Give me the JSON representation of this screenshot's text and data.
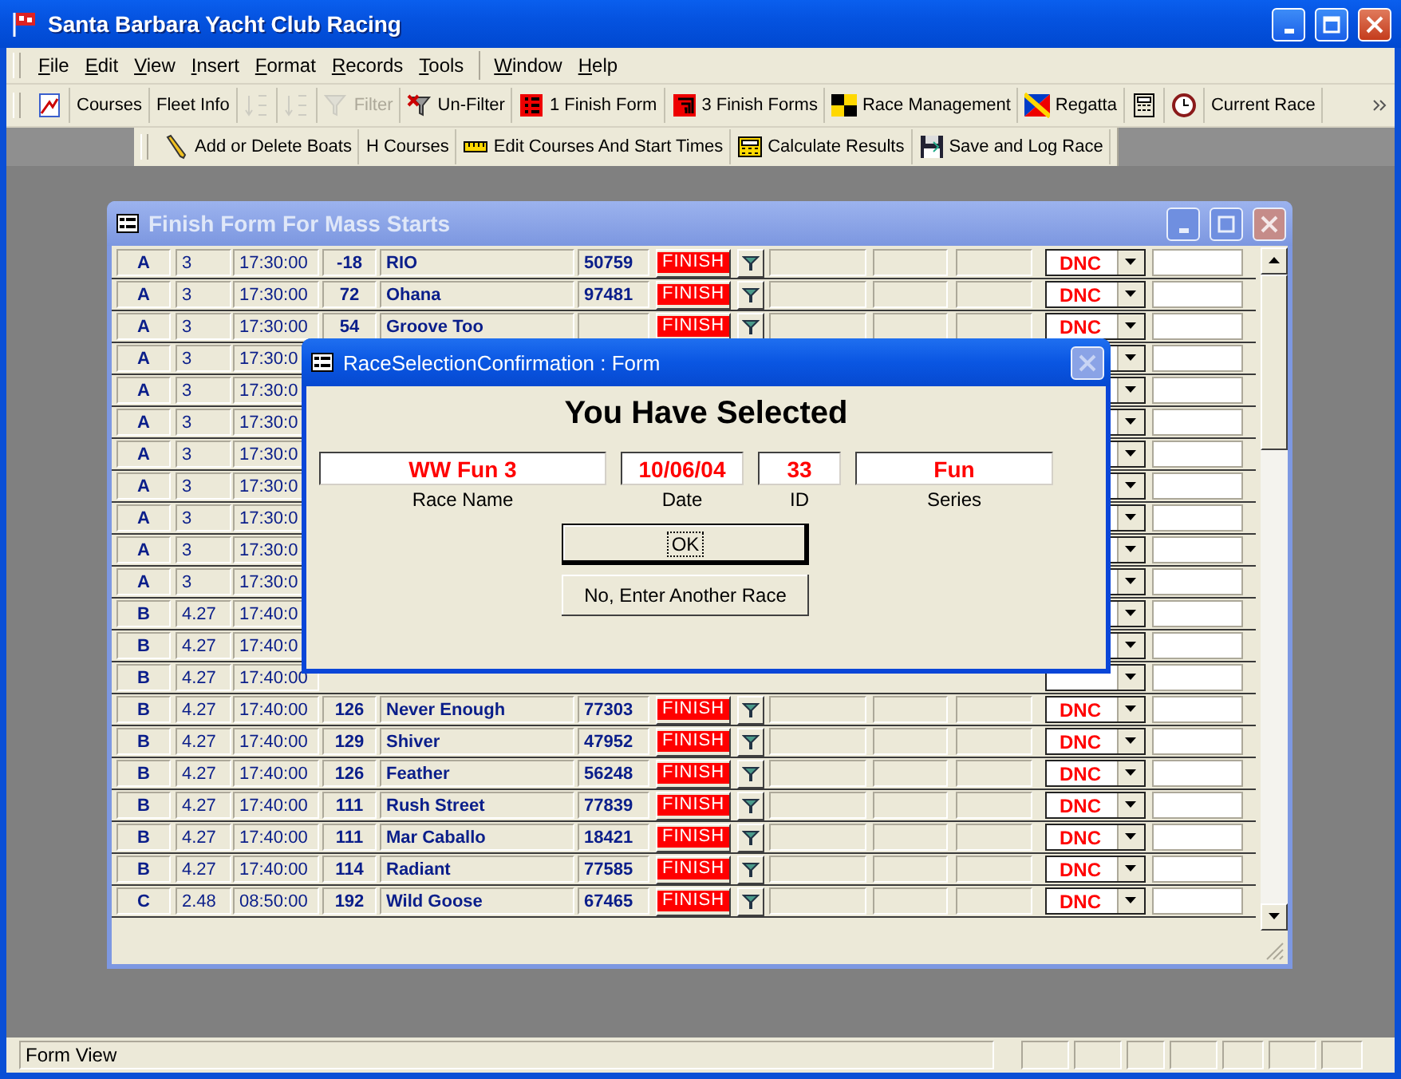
{
  "window": {
    "title": "Santa Barbara Yacht Club Racing"
  },
  "menu": [
    [
      {
        "label": "File"
      },
      {
        "label": "Edit"
      },
      {
        "label": "View"
      },
      {
        "label": "Insert"
      },
      {
        "label": "Format"
      },
      {
        "label": "Records"
      },
      {
        "label": "Tools"
      }
    ],
    [
      {
        "label": "Window"
      },
      {
        "label": "Help"
      }
    ]
  ],
  "toolbar": [
    {
      "kind": "icon",
      "disabled": false
    },
    {
      "kind": "text",
      "label": "Courses",
      "disabled": false
    },
    {
      "kind": "text",
      "label": "Fleet Info",
      "disabled": false
    },
    {
      "kind": "icon",
      "disabled": true
    },
    {
      "kind": "icon",
      "disabled": true
    },
    {
      "kind": "icon-text",
      "label": "Filter",
      "disabled": true
    },
    {
      "kind": "icon-text",
      "label": "Un-Filter",
      "disabled": false
    },
    {
      "kind": "icon-text",
      "label": "1 Finish Form",
      "disabled": false
    },
    {
      "kind": "icon-text",
      "label": "3 Finish Forms",
      "disabled": false
    },
    {
      "kind": "icon-text",
      "label": "Race Management",
      "disabled": false
    },
    {
      "kind": "icon-text",
      "label": "Regatta",
      "disabled": false
    },
    {
      "kind": "icon",
      "disabled": false
    },
    {
      "kind": "icon",
      "disabled": false
    },
    {
      "kind": "text",
      "label": "Current Race",
      "disabled": false
    }
  ],
  "toolbar_2": [
    {
      "kind": "icon-text",
      "label": "Add or Delete Boats"
    },
    {
      "kind": "text",
      "label": "H Courses"
    },
    {
      "kind": "icon-text",
      "label": "Edit Courses And Start Times"
    },
    {
      "kind": "icon-text",
      "label": "Calculate Results"
    },
    {
      "kind": "icon-text",
      "label": "Save and Log Race"
    }
  ],
  "finish_form": {
    "title": "Finish Form For Mass Starts",
    "rows": [
      {
        "kind": "full",
        "class": "A",
        "rating": "3",
        "start": "17:30:00",
        "handicap": "-18",
        "boat": "RIO",
        "sail": "50759",
        "finish": "FINISH",
        "status": "DNC"
      },
      {
        "kind": "full",
        "class": "A",
        "rating": "3",
        "start": "17:30:00",
        "handicap": "72",
        "boat": "Ohana",
        "sail": "97481",
        "finish": "FINISH",
        "status": "DNC"
      },
      {
        "kind": "full",
        "class": "A",
        "rating": "3",
        "start": "17:30:00",
        "handicap": "54",
        "boat": "Groove Too",
        "finish": "FINISH",
        "status": "DNC"
      },
      {
        "kind": "covered",
        "class": "A",
        "rating": "3",
        "start": "17:30:0"
      },
      {
        "kind": "covered",
        "class": "A",
        "rating": "3",
        "start": "17:30:0"
      },
      {
        "kind": "covered",
        "class": "A",
        "rating": "3",
        "start": "17:30:0"
      },
      {
        "kind": "covered",
        "class": "A",
        "rating": "3",
        "start": "17:30:0"
      },
      {
        "kind": "covered",
        "class": "A",
        "rating": "3",
        "start": "17:30:0"
      },
      {
        "kind": "covered",
        "class": "A",
        "rating": "3",
        "start": "17:30:0"
      },
      {
        "kind": "covered",
        "class": "A",
        "rating": "3",
        "start": "17:30:0"
      },
      {
        "kind": "covered",
        "class": "A",
        "rating": "3",
        "start": "17:30:0"
      },
      {
        "kind": "covered",
        "class": "B",
        "rating": "4.27",
        "start": "17:40:0"
      },
      {
        "kind": "covered",
        "class": "B",
        "rating": "4.27",
        "start": "17:40:0"
      },
      {
        "kind": "covered",
        "class": "B",
        "rating": "4.27",
        "start": "17:40:00"
      },
      {
        "kind": "full",
        "class": "B",
        "rating": "4.27",
        "start": "17:40:00",
        "handicap": "126",
        "boat": "Never Enough",
        "sail": "77303",
        "finish": "FINISH",
        "status": "DNC"
      },
      {
        "kind": "full",
        "class": "B",
        "rating": "4.27",
        "start": "17:40:00",
        "handicap": "129",
        "boat": "Shiver",
        "sail": "47952",
        "finish": "FINISH",
        "status": "DNC"
      },
      {
        "kind": "full",
        "class": "B",
        "rating": "4.27",
        "start": "17:40:00",
        "handicap": "126",
        "boat": "Feather",
        "sail": "56248",
        "finish": "FINISH",
        "status": "DNC"
      },
      {
        "kind": "full",
        "class": "B",
        "rating": "4.27",
        "start": "17:40:00",
        "handicap": "111",
        "boat": "Rush Street",
        "sail": "77839",
        "finish": "FINISH",
        "status": "DNC"
      },
      {
        "kind": "full",
        "class": "B",
        "rating": "4.27",
        "start": "17:40:00",
        "handicap": "111",
        "boat": "Mar Caballo",
        "sail": "18421",
        "finish": "FINISH",
        "status": "DNC"
      },
      {
        "kind": "full",
        "class": "B",
        "rating": "4.27",
        "start": "17:40:00",
        "handicap": "114",
        "boat": "Radiant",
        "sail": "77585",
        "finish": "FINISH",
        "status": "DNC"
      },
      {
        "kind": "full",
        "class": "C",
        "rating": "2.48",
        "start": "08:50:00",
        "handicap": "192",
        "boat": "Wild Goose",
        "sail": "67465",
        "finish": "FINISH",
        "status": "DNC"
      }
    ]
  },
  "dialog": {
    "title": "RaceSelectionConfirmation : Form",
    "heading": "You Have Selected",
    "fields": [
      {
        "label": "Race Name",
        "value": "WW Fun 3"
      },
      {
        "label": "Date",
        "value": "10/06/04"
      },
      {
        "label": "ID",
        "value": "33"
      },
      {
        "label": "Series",
        "value": "Fun"
      }
    ],
    "buttons": [
      {
        "label": "OK",
        "focused": true
      },
      {
        "label": "No, Enter Another Race",
        "focused": false
      }
    ]
  },
  "status_bar": {
    "text": "Form View"
  }
}
